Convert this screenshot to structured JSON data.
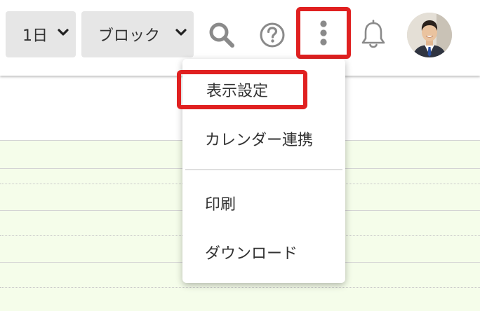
{
  "toolbar": {
    "day_select_label": "1日",
    "view_select_label": "ブロック",
    "icons": {
      "search": "search-icon",
      "help": "help-icon",
      "more": "more-vertical-icon",
      "notifications": "bell-icon",
      "avatar": "user-avatar"
    }
  },
  "menu": {
    "items": [
      {
        "label": "表示設定",
        "highlighted": true
      },
      {
        "label": "カレンダー連携",
        "highlighted": false
      },
      {
        "label": "印刷",
        "highlighted": false
      },
      {
        "label": "ダウンロード",
        "highlighted": false
      }
    ]
  },
  "colors": {
    "highlight_outline": "#e02020",
    "calendar_fill": "#f5fdea",
    "icon_gray": "#8a8a8a",
    "button_gray": "#e6e6e6"
  }
}
